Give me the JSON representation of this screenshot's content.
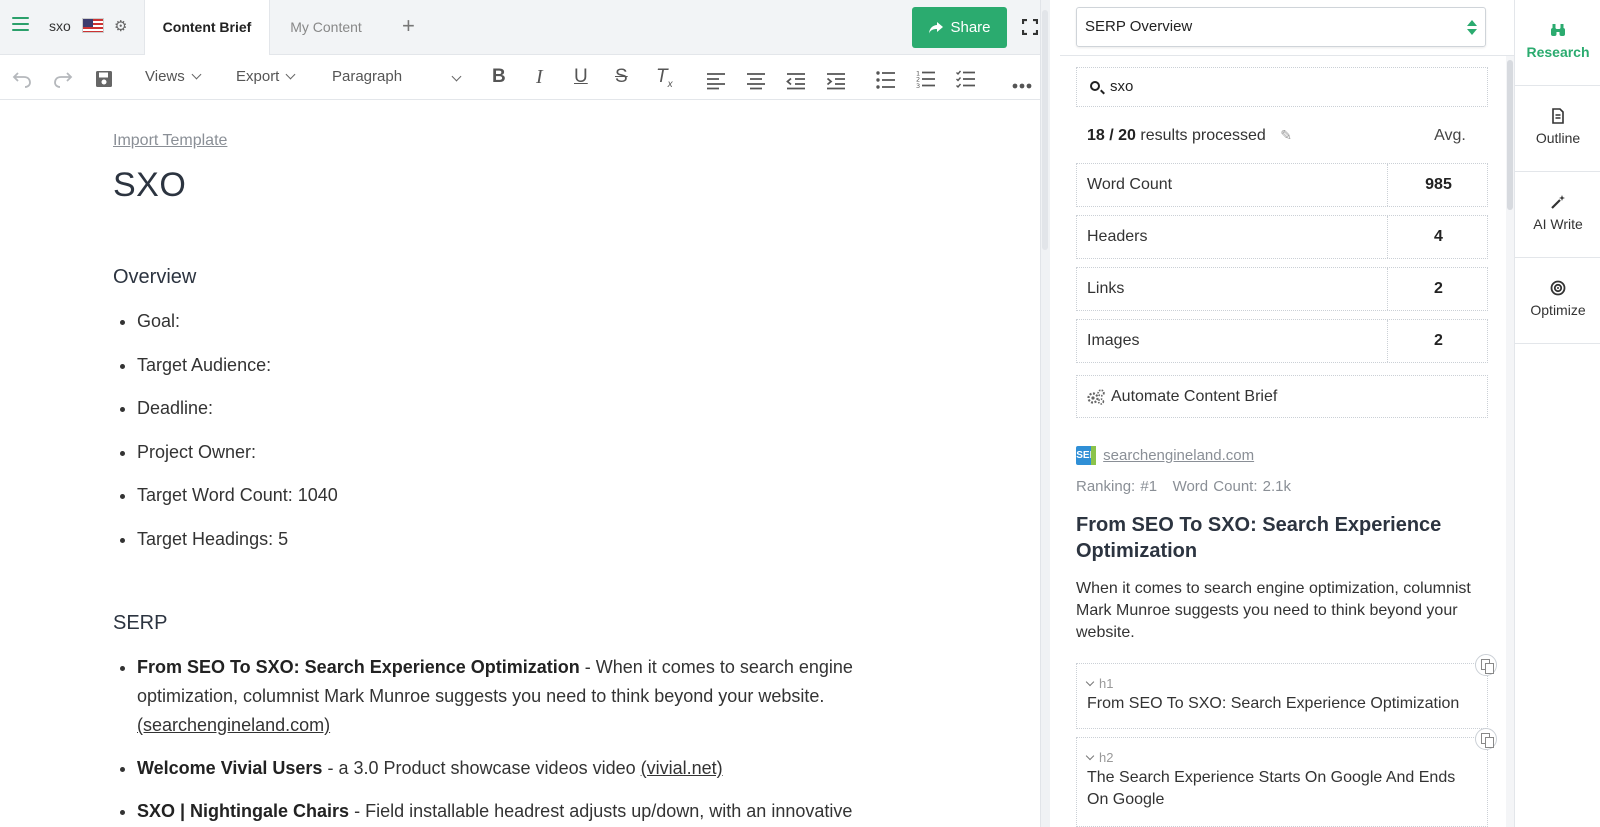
{
  "topbar": {
    "doc_name": "sxo",
    "tabs": [
      {
        "label": "Content Brief",
        "active": true
      },
      {
        "label": "My Content",
        "active": false
      }
    ],
    "share_label": "Share",
    "accent_color": "#2bab6f"
  },
  "toolbar": {
    "views_label": "Views",
    "export_label": "Export",
    "block_format": "Paragraph"
  },
  "document": {
    "import_template": "Import Template",
    "title": "SXO",
    "overview_heading": "Overview",
    "overview_items": [
      "Goal:",
      "Target Audience:",
      "Deadline:",
      "Project Owner:",
      "Target Word Count: 1040",
      "Target Headings: 5"
    ],
    "serp_heading": "SERP",
    "serp_items": [
      {
        "title": "From SEO To SXO: Search Experience Optimization",
        "desc": " - When it comes to search engine optimization, columnist Mark Munroe suggests you need to think beyond your website. ",
        "source": "(searchengineland.com)"
      },
      {
        "title": "Welcome Vivial Users",
        "desc": " - a 3.0 Product showcase videos video ",
        "source": "(vivial.net)"
      },
      {
        "title": "SXO | Nightingale Chairs",
        "desc": " - Field installable headrest adjusts up/down, with an innovative",
        "source": ""
      }
    ]
  },
  "research": {
    "view_select": "SERP Overview",
    "search_value": "sxo",
    "processed": "18 / 20",
    "processed_suffix": "results processed",
    "avg_label": "Avg.",
    "stats": [
      {
        "label": "Word Count",
        "value": "985"
      },
      {
        "label": "Headers",
        "value": "4"
      },
      {
        "label": "Links",
        "value": "2"
      },
      {
        "label": "Images",
        "value": "2"
      }
    ],
    "automate_label": "Automate Content Brief",
    "result": {
      "site_logo_text": "SEL",
      "site": "searchengineland.com",
      "ranking": "Ranking: #1",
      "word_count": "Word Count: 2.1k",
      "title": "From SEO To SXO: Search Experience Optimization",
      "description": "When it comes to search engine optimization, columnist Mark Munroe suggests you need to think beyond your website.",
      "headings": [
        {
          "tag": "h1",
          "text": "From SEO To SXO: Search Experience Optimization"
        },
        {
          "tag": "h2",
          "text": "The Search Experience Starts On Google And Ends On Google"
        }
      ]
    }
  },
  "side_nav": [
    {
      "label": "Research",
      "icon": "binoculars-icon",
      "active": true
    },
    {
      "label": "Outline",
      "icon": "document-icon",
      "active": false
    },
    {
      "label": "AI Write",
      "icon": "magic-wand-icon",
      "active": false
    },
    {
      "label": "Optimize",
      "icon": "target-icon",
      "active": false
    }
  ]
}
